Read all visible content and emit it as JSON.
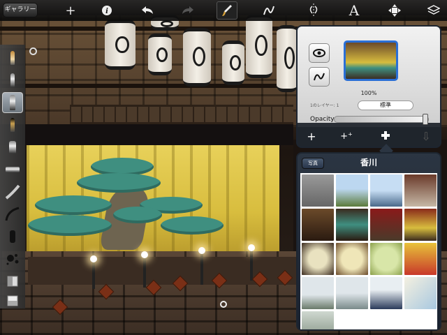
{
  "toolbar": {
    "gallery_label": "ギャラリー",
    "icons": [
      "plus-icon",
      "info-icon",
      "undo-icon",
      "redo-icon",
      "brush-icon",
      "curve-icon",
      "symmetry-icon",
      "text-icon",
      "transform-icon",
      "layers-icon"
    ],
    "text_tool_glyph": "A"
  },
  "brushes": [
    "pencil",
    "pen",
    "airbrush-selected",
    "marker",
    "eraser-tip",
    "flat-brush",
    "wet-brush",
    "curve-brush",
    "chisel",
    "splatter",
    "smudge",
    "fill"
  ],
  "layers_panel": {
    "opacity_percent_text": "100%",
    "layer_label": "1のレイヤー: 1",
    "blend_mode": "標準",
    "opacity_label": "Opacity",
    "opacity_value": 1.0
  },
  "album": {
    "back_label": "写真",
    "title": "香川",
    "photo_count": 17
  },
  "colors": {
    "accent_blue": "#2a6fd6",
    "panel_dark": "#1f252c",
    "curtain_gold": "#d8bd3e",
    "pine_green": "#3f8f80"
  }
}
